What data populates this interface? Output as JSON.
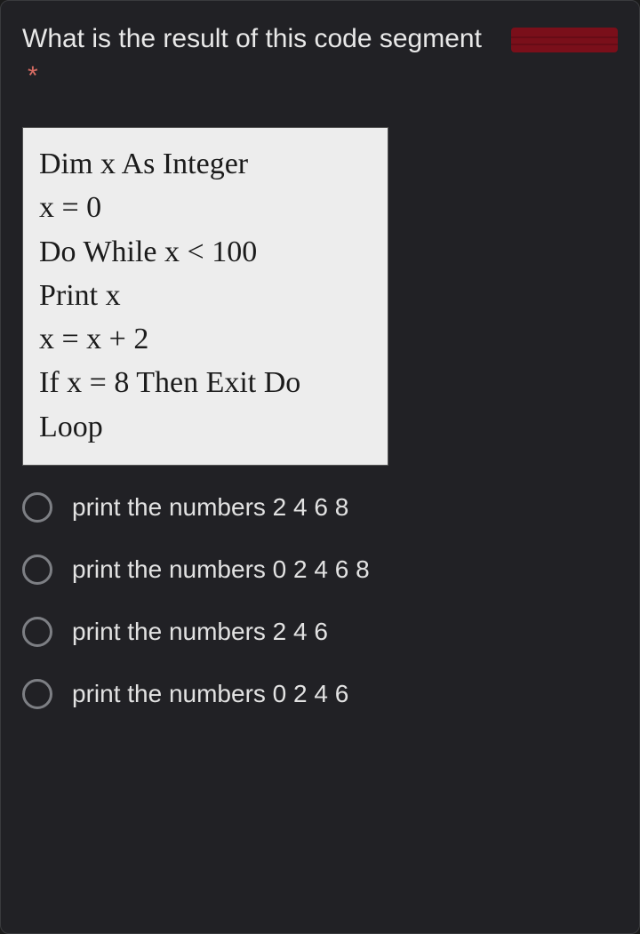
{
  "question": {
    "text": "What is the result of this code segment",
    "required_marker": "*"
  },
  "code": {
    "lines": [
      "Dim x As Integer",
      "x = 0",
      "Do While x < 100",
      "Print x",
      "x = x + 2",
      "If x = 8 Then Exit Do",
      "Loop"
    ]
  },
  "options": [
    {
      "label": "print the numbers 2 4 6 8"
    },
    {
      "label": "print the numbers 0 2 4 6 8"
    },
    {
      "label": "print the numbers 2 4 6"
    },
    {
      "label": "print the numbers 0 2 4 6"
    }
  ]
}
